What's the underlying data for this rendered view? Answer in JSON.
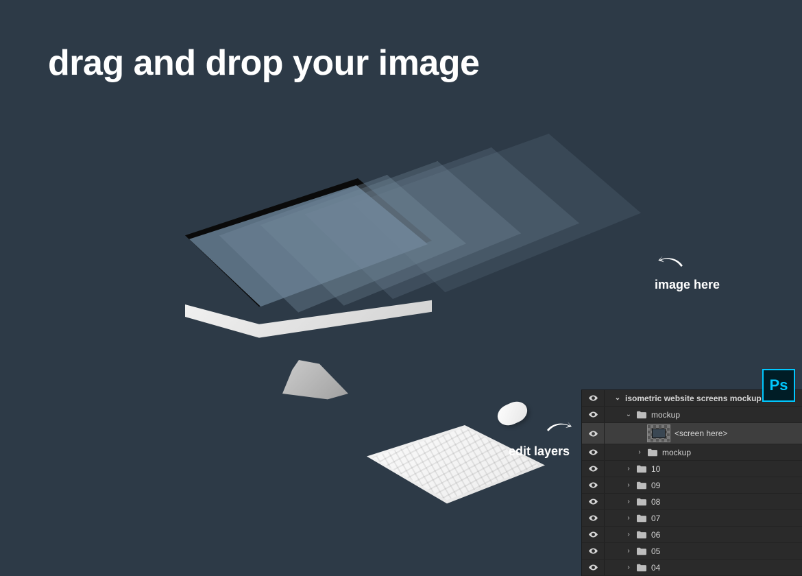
{
  "headline": "drag and drop your image",
  "callouts": {
    "image_here": "image here",
    "edit_layers": "edit layers"
  },
  "ps_badge": "Ps",
  "panel": {
    "rows": [
      {
        "indent": 0,
        "toggle": "down",
        "icon": "none",
        "label": "isometric website screens mockup",
        "bold": true,
        "selected": false
      },
      {
        "indent": 1,
        "toggle": "down",
        "icon": "folder",
        "label": "mockup",
        "bold": false,
        "selected": false
      },
      {
        "indent": 2,
        "toggle": "none",
        "icon": "thumb",
        "label": "<screen here>",
        "bold": false,
        "selected": true
      },
      {
        "indent": 2,
        "toggle": "right",
        "icon": "folder",
        "label": "mockup",
        "bold": false,
        "selected": false
      },
      {
        "indent": 1,
        "toggle": "right",
        "icon": "folder",
        "label": "10",
        "bold": false,
        "selected": false
      },
      {
        "indent": 1,
        "toggle": "right",
        "icon": "folder",
        "label": "09",
        "bold": false,
        "selected": false
      },
      {
        "indent": 1,
        "toggle": "right",
        "icon": "folder",
        "label": "08",
        "bold": false,
        "selected": false
      },
      {
        "indent": 1,
        "toggle": "right",
        "icon": "folder",
        "label": "07",
        "bold": false,
        "selected": false
      },
      {
        "indent": 1,
        "toggle": "right",
        "icon": "folder",
        "label": "06",
        "bold": false,
        "selected": false
      },
      {
        "indent": 1,
        "toggle": "right",
        "icon": "folder",
        "label": "05",
        "bold": false,
        "selected": false
      },
      {
        "indent": 1,
        "toggle": "right",
        "icon": "folder",
        "label": "04",
        "bold": false,
        "selected": false
      }
    ]
  }
}
